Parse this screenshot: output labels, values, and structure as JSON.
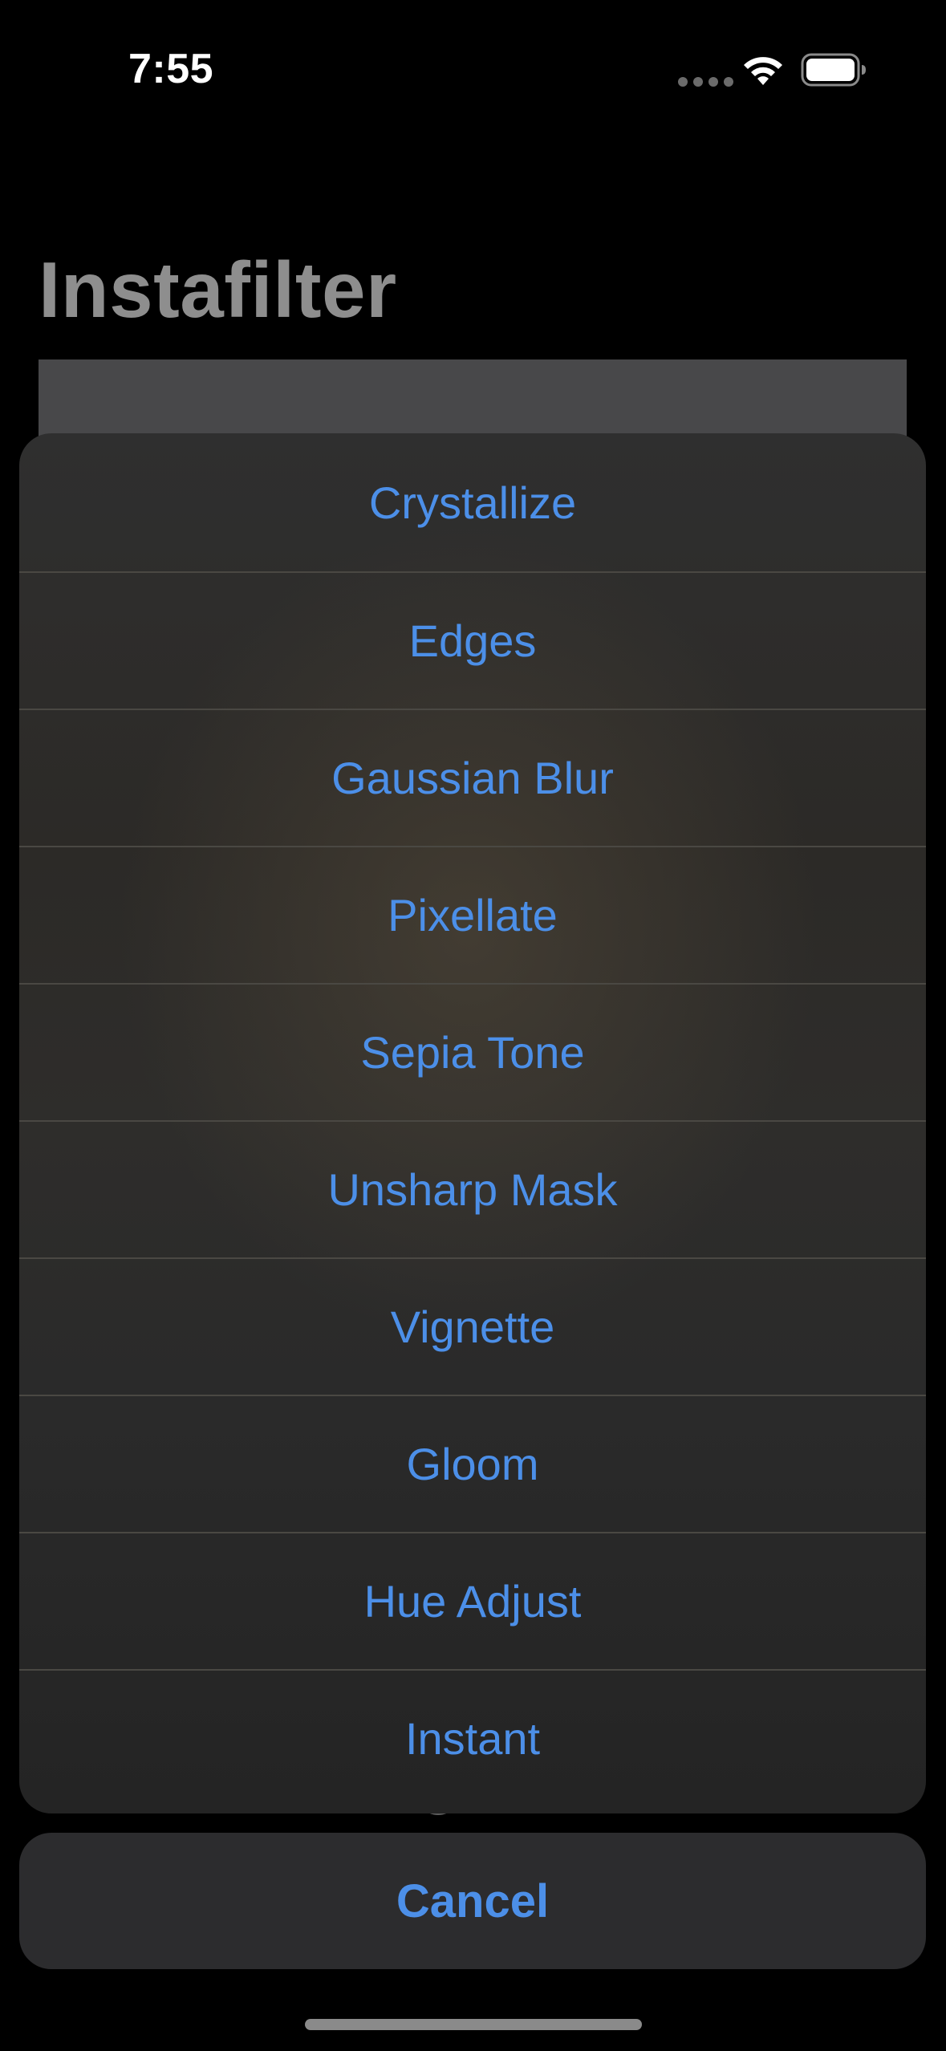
{
  "status_bar": {
    "time": "7:55",
    "icons": [
      "cellular-signal-icon",
      "wifi-icon",
      "battery-icon"
    ]
  },
  "navigation": {
    "title": "Instafilter"
  },
  "action_sheet": {
    "items": [
      {
        "label": "Crystallize"
      },
      {
        "label": "Edges"
      },
      {
        "label": "Gaussian Blur"
      },
      {
        "label": "Pixellate"
      },
      {
        "label": "Sepia Tone"
      },
      {
        "label": "Unsharp Mask"
      },
      {
        "label": "Vignette"
      },
      {
        "label": "Gloom"
      },
      {
        "label": "Hue Adjust"
      },
      {
        "label": "Instant"
      }
    ],
    "cancel_label": "Cancel"
  },
  "colors": {
    "accent": "#4c8fe8",
    "title_gray": "#8e8e8e",
    "background": "#000000"
  }
}
